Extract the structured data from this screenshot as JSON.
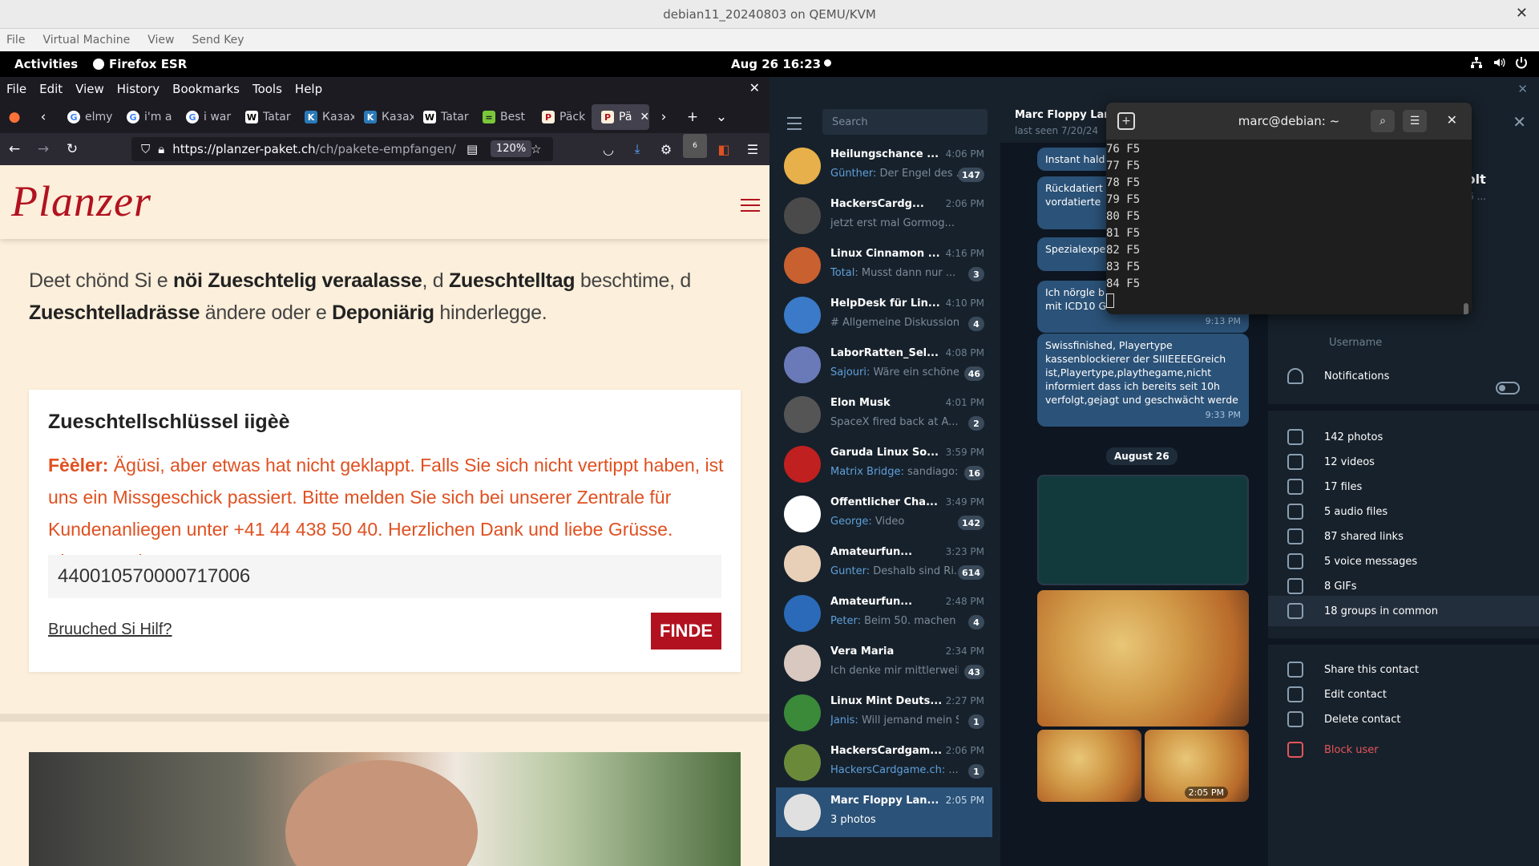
{
  "vm": {
    "title": "debian11_20240803 on QEMU/KVM",
    "menu": [
      "File",
      "Virtual Machine",
      "View",
      "Send Key"
    ]
  },
  "gnome": {
    "activities": "Activities",
    "app_name": "Firefox ESR",
    "clock": "Aug 26  16:23"
  },
  "firefox": {
    "menubar": [
      "File",
      "Edit",
      "View",
      "History",
      "Bookmarks",
      "Tools",
      "Help"
    ],
    "tabs": [
      {
        "label": "elmy",
        "icon": "G"
      },
      {
        "label": "i'm a",
        "icon": "G"
      },
      {
        "label": "i war",
        "icon": "G"
      },
      {
        "label": "Tatar",
        "icon": "W"
      },
      {
        "label": "Казах",
        "icon": "K"
      },
      {
        "label": "Казах",
        "icon": "K"
      },
      {
        "label": "Tatar",
        "icon": "W"
      },
      {
        "label": "Best",
        "icon": "="
      },
      {
        "label": "Päck",
        "icon": "P"
      },
      {
        "label": "Pä",
        "icon": "P"
      }
    ],
    "url_host": "https://planzer-paket.ch",
    "url_path": "/ch/pakete-empfangen/",
    "zoom": "120%",
    "notification_count": "6"
  },
  "page": {
    "logo": "Planzer",
    "intro_parts": [
      "Deet chönd Si e ",
      "nöi Zueschtelig veraalasse",
      ", d ",
      "Zueschtelltag",
      " beschtime, d ",
      "Zueschtelladrässe",
      " ändere oder e ",
      "Deponiärig",
      " hinderlegge."
    ],
    "card_title": "Zueschtellschlüssel iigèè",
    "error_label": "Fèèler:",
    "error_text": " Ägüsi, aber etwas hat nicht geklappt. Falls Sie sich nicht vertippt haben, ist uns ein Missgeschick passiert. Bitte melden Sie sich bei unserer Zentrale für Kundenanliegen unter +41 44 438 50 40. Herzlichen Dank und liebe Grüsse. Planzer Paket.",
    "tracking_value": "440010570000717006",
    "help_link": "Bruuched Si Hilf?",
    "finde_button": "FINDE"
  },
  "telegram": {
    "search_placeholder": "Search",
    "chats": [
      {
        "name": "Heilungschance ...",
        "time": "4:06 PM",
        "sender": "Günther:",
        "preview": " Der Engel des ...",
        "badge": "147",
        "color": "#e8b04a"
      },
      {
        "name": "HackersCardg...",
        "time": "2:06 PM",
        "sender": "",
        "preview": "jetzt erst mal Gormog...",
        "badge": "",
        "color": "#4a4a4a"
      },
      {
        "name": "Linux Cinnamon ...",
        "time": "4:16 PM",
        "sender": "Total",
        "preview": ": Musst dann nur ...",
        "badge": "3",
        "color": "#c86030"
      },
      {
        "name": "HelpDesk für Lin...",
        "time": "4:10 PM",
        "sender": "",
        "preview": "# Allgemeine Diskussions...",
        "badge": "4",
        "color": "#3a7ac8"
      },
      {
        "name": "LaborRatten_Sel...",
        "time": "4:08 PM",
        "sender": "Sajouri:",
        "preview": " Wäre ein schöne...",
        "badge": "46",
        "color": "#6a7ab8"
      },
      {
        "name": "Elon Musk",
        "time": "4:01 PM",
        "sender": "",
        "preview": "SpaceX fired back at A...",
        "badge": "2",
        "color": "#555555"
      },
      {
        "name": "Garuda Linux So...",
        "time": "3:59 PM",
        "sender": "Matrix Bridge:",
        "preview": " sandiago: ...",
        "badge": "16",
        "color": "#c02020"
      },
      {
        "name": "Öffentlicher Cha...",
        "time": "3:49 PM",
        "sender": "George:",
        "preview": " Video",
        "badge": "142",
        "color": "#ffffff"
      },
      {
        "name": "Amateurfun...",
        "time": "3:23 PM",
        "sender": "Gunter:",
        "preview": " Deshalb sind Ri...",
        "badge": "614",
        "color": "#e8d0b8"
      },
      {
        "name": "Amateurfun...",
        "time": "2:48 PM",
        "sender": "Peter:",
        "preview": " Beim 50. machen ...",
        "badge": "4",
        "color": "#2a6ab8"
      },
      {
        "name": "Vera Maria",
        "time": "2:34 PM",
        "sender": "",
        "preview": "Ich denke mir mittlerweil...",
        "badge": "43",
        "color": "#d8c8c0"
      },
      {
        "name": "Linux Mint Deuts...",
        "time": "2:27 PM",
        "sender": "Janis:",
        "preview": " Will jemand mein St...",
        "badge": "1",
        "color": "#3a8a3a"
      },
      {
        "name": "HackersCardgam...",
        "time": "2:06 PM",
        "sender": "HackersCardgame.ch:",
        "preview": " ...",
        "badge": "1",
        "color": "#6a8a3a"
      },
      {
        "name": "Marc Floppy Lan...",
        "time": "2:05 PM",
        "sender": "",
        "preview": "3 photos",
        "badge": "",
        "color": "#e0e0e0"
      }
    ],
    "chat_header_name": "Marc Floppy Landolt",
    "chat_header_status": "last seen 7/20/24",
    "bubbles": [
      {
        "text": "Instant hald",
        "time": ""
      },
      {
        "text": "Rückdatiert automatisch Infektionspf vordatierte",
        "time": ""
      },
      {
        "text": "Spezialexpe Orang-Utan",
        "time": ""
      },
      {
        "text": "Ich nörgle b afrikanische Kassiererin mit ICD10 G40.2",
        "time": "9:13 PM"
      },
      {
        "text": "Swissfinished, Playertype kassenblockierer der SIIIEEEEGreich ist,Playertype,playthegame,nicht informiert dass ich bereits seit 10h verfolgt,gejagt und geschwächt werde",
        "time": "9:33 PM"
      }
    ],
    "date_pill": "August 26",
    "photo_time": "2:05 PM",
    "info": {
      "name_partial": "andolt",
      "status_partial": "at 1:56 ...",
      "username_label": "Username",
      "notifications": "Notifications",
      "media": [
        {
          "label": "142 photos",
          "icon": "photo-icon"
        },
        {
          "label": "12 videos",
          "icon": "video-icon"
        },
        {
          "label": "17 files",
          "icon": "file-icon"
        },
        {
          "label": "5 audio files",
          "icon": "headphones-icon"
        },
        {
          "label": "87 shared links",
          "icon": "link-icon"
        },
        {
          "label": "5 voice messages",
          "icon": "mic-icon"
        },
        {
          "label": "8 GIFs",
          "icon": "gif-icon"
        },
        {
          "label": "18 groups in common",
          "icon": "groups-icon"
        }
      ],
      "actions": [
        {
          "label": "Share this contact",
          "icon": "share-icon"
        },
        {
          "label": "Edit contact",
          "icon": "edit-icon"
        },
        {
          "label": "Delete contact",
          "icon": "trash-icon"
        },
        {
          "label": "Block user",
          "icon": "block-icon"
        }
      ]
    }
  },
  "terminal": {
    "title": "marc@debian: ~",
    "lines": [
      "76 F5",
      "77 F5",
      "78 F5",
      "79 F5",
      "80 F5",
      "81 F5",
      "82 F5",
      "83 F5",
      "84 F5"
    ]
  }
}
